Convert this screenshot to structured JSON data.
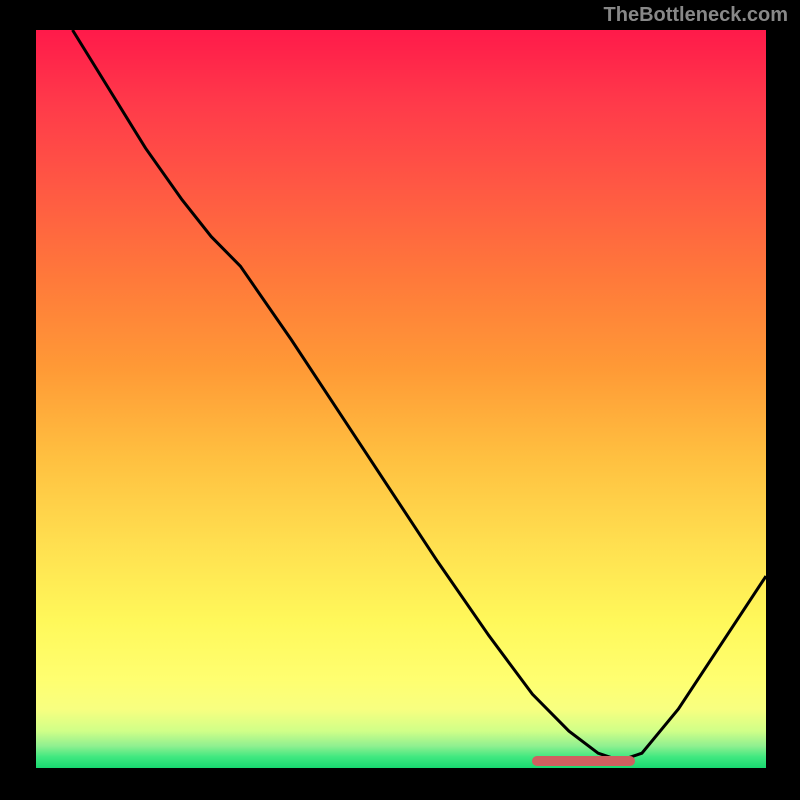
{
  "attribution": "TheBottleneck.com",
  "chart_data": {
    "type": "line",
    "title": "",
    "xlabel": "",
    "ylabel": "",
    "xlim": [
      0,
      100
    ],
    "ylim": [
      0,
      100
    ],
    "series": [
      {
        "name": "curve",
        "x": [
          5,
          10,
          15,
          20,
          24,
          28,
          35,
          45,
          55,
          62,
          68,
          73,
          77,
          80,
          83,
          88,
          100
        ],
        "y": [
          100,
          92,
          84,
          77,
          72,
          68,
          58,
          43,
          28,
          18,
          10,
          5,
          2,
          1,
          2,
          8,
          26
        ]
      }
    ],
    "annotations": [
      {
        "name": "optimal-marker",
        "x_start": 68,
        "x_end": 82,
        "y": 1
      }
    ],
    "background": "red-yellow-green vertical gradient"
  }
}
